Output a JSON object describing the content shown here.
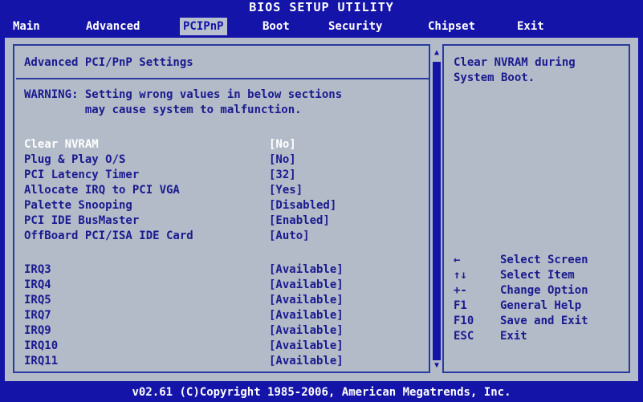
{
  "window": {
    "title": "BIOS SETUP UTILITY"
  },
  "menu": {
    "items": [
      {
        "label": "Main"
      },
      {
        "label": "Advanced"
      },
      {
        "label": "PCIPnP"
      },
      {
        "label": "Boot"
      },
      {
        "label": "Security"
      },
      {
        "label": "Chipset"
      },
      {
        "label": "Exit"
      }
    ],
    "active": "PCIPnP"
  },
  "section": {
    "title": "Advanced PCI/PnP Settings",
    "warning_line1": "WARNING: Setting wrong values in below sections",
    "warning_line2": "         may cause system to malfunction."
  },
  "settings": [
    {
      "label": "Clear NVRAM",
      "value": "[No]"
    },
    {
      "label": "Plug & Play O/S",
      "value": "[No]"
    },
    {
      "label": "PCI Latency Timer",
      "value": "[32]"
    },
    {
      "label": "Allocate IRQ to PCI VGA",
      "value": "[Yes]"
    },
    {
      "label": "Palette Snooping",
      "value": "[Disabled]"
    },
    {
      "label": "PCI IDE BusMaster",
      "value": "[Enabled]"
    },
    {
      "label": "OffBoard PCI/ISA IDE Card",
      "value": "[Auto]"
    }
  ],
  "irqs": [
    {
      "label": "IRQ3",
      "value": "[Available]"
    },
    {
      "label": "IRQ4",
      "value": "[Available]"
    },
    {
      "label": "IRQ5",
      "value": "[Available]"
    },
    {
      "label": "IRQ7",
      "value": "[Available]"
    },
    {
      "label": "IRQ9",
      "value": "[Available]"
    },
    {
      "label": "IRQ10",
      "value": "[Available]"
    },
    {
      "label": "IRQ11",
      "value": "[Available]"
    }
  ],
  "help": {
    "text_line1": "Clear NVRAM during",
    "text_line2": "System Boot."
  },
  "keys": [
    {
      "key": "←",
      "action": "Select Screen"
    },
    {
      "key": "↑↓",
      "action": "Select Item"
    },
    {
      "key": "+-",
      "action": "Change Option"
    },
    {
      "key": "F1",
      "action": "General Help"
    },
    {
      "key": "F10",
      "action": "Save and Exit"
    },
    {
      "key": "ESC",
      "action": "Exit"
    }
  ],
  "footer": {
    "text": "v02.61 (C)Copyright 1985-2006, American Megatrends, Inc."
  },
  "colors": {
    "background": "#1414a8",
    "panel": "#b3bbc9",
    "text": "#1a1a8e",
    "highlight": "#ffffff"
  }
}
